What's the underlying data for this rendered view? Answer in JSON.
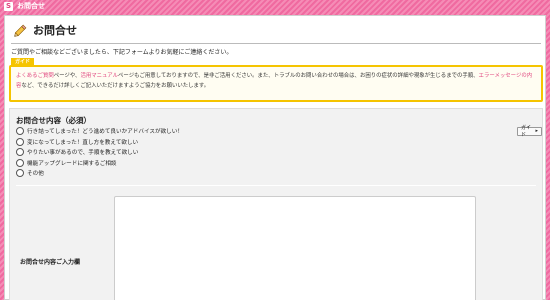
{
  "topbar": {
    "icon": "page-icon",
    "icon_glyph": "S",
    "title": "お問合せ"
  },
  "page": {
    "title": "お問合せ",
    "icon": "pencil-icon"
  },
  "intro": "ご質問やご相談などございましたら、下記フォームよりお気軽にご連絡ください。",
  "guide": {
    "tag": "ガイド",
    "parts": [
      {
        "text": "よくあるご質問",
        "highlight": true
      },
      {
        "text": "ページや、",
        "highlight": false
      },
      {
        "text": "活用マニュアル",
        "highlight": true
      },
      {
        "text": "ページもご用意しておりますので、是非ご活用ください。また、トラブルのお問い合わせの場合は、お困りの症状の詳細や現象が生じるまでの手順、",
        "highlight": false
      },
      {
        "text": "エラーメッセージの内容",
        "highlight": true
      },
      {
        "text": "など、できるだけ詳しくご記入いただけますようご協力をお願いいたします。",
        "highlight": false
      }
    ]
  },
  "form": {
    "heading": "お問合せ内容（必須）",
    "options": [
      "行き詰ってしまった！どう進めて良いかアドバイスが欲しい！",
      "変になってしまった！直し方を教えて欲しい",
      "やりたい事があるので、手順を教えて欲しい",
      "機能アップグレードに関するご相談",
      "その他"
    ],
    "guide_button": "ガイド",
    "textarea_label": "お問合せ内容ご入力欄",
    "textarea_value": ""
  },
  "colors": {
    "accent": "#f06aa0",
    "guide_border": "#f5c400",
    "highlight_text": "#e0467f"
  }
}
